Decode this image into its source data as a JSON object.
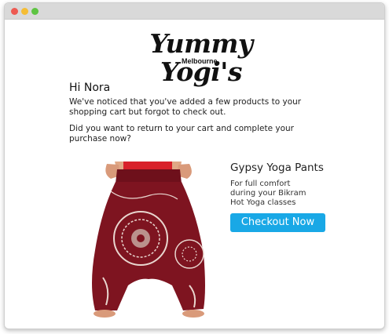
{
  "brand": {
    "name": "Yummy Yogi's",
    "location": "Melbourne"
  },
  "email": {
    "greeting": "Hi Nora",
    "paragraph1": "We've noticed that you've added a few products to your shopping cart but forgot to check out.",
    "paragraph2": "Did you want to return to your cart and complete your purchase now?"
  },
  "product": {
    "name": "Gypsy Yoga Pants",
    "description": "For full comfort during your Bikram Hot Yoga classes",
    "button_label": "Checkout Now",
    "image_icon": "harem-pants-photo"
  },
  "colors": {
    "button": "#19a8e6",
    "pants": "#7e1420",
    "top": "#d8202a"
  }
}
